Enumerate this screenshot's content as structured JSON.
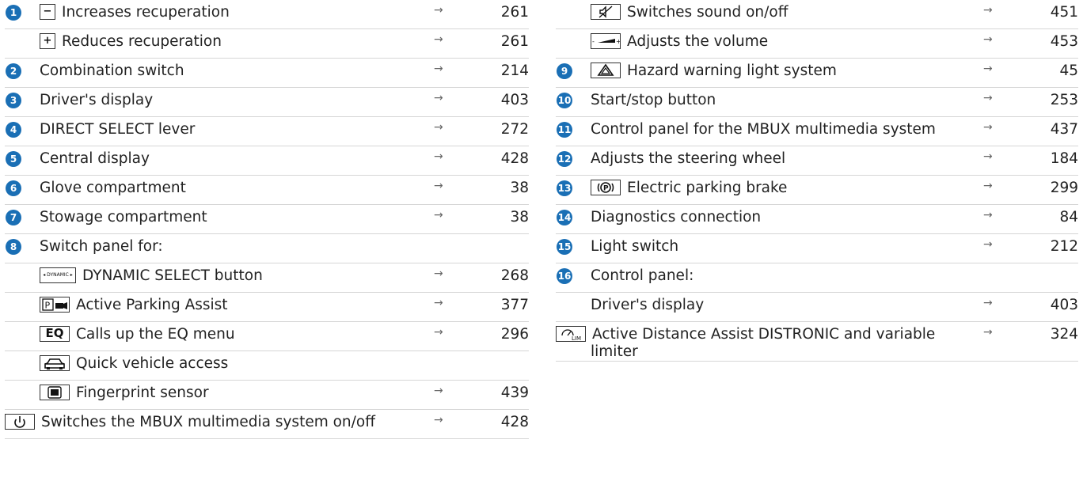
{
  "arrow": "→",
  "left": [
    {
      "badge": "1",
      "key": "minus",
      "key_text": "−",
      "text": "Increases recuperation",
      "page": "261"
    },
    {
      "badge": "",
      "key": "plus",
      "key_text": "+",
      "text": "Reduces recuperation",
      "page": "261"
    },
    {
      "badge": "2",
      "key": "",
      "text": "Combination switch",
      "page": "214"
    },
    {
      "badge": "3",
      "key": "",
      "text": "Driver's display",
      "page": "403"
    },
    {
      "badge": "4",
      "key": "",
      "text": "DIRECT SELECT lever",
      "page": "272"
    },
    {
      "badge": "5",
      "key": "",
      "text": "Central display",
      "page": "428"
    },
    {
      "badge": "6",
      "key": "",
      "text": "Glove compartment",
      "page": "38"
    },
    {
      "badge": "7",
      "key": "",
      "text": "Stowage compartment",
      "page": "38"
    },
    {
      "badge": "8",
      "key": "",
      "text": "Switch panel for:",
      "page": ""
    },
    {
      "badge": "",
      "key": "dynamic",
      "key_text": "DYNAMIC",
      "text": "DYNAMIC SELECT button",
      "page": "268"
    },
    {
      "badge": "",
      "key": "parking",
      "key_text": "P",
      "text": "Active Parking Assist",
      "page": "377"
    },
    {
      "badge": "",
      "key": "eq",
      "key_text": "EQ",
      "text": "Calls up the EQ menu",
      "page": "296"
    },
    {
      "badge": "",
      "key": "car",
      "text": "Quick vehicle access",
      "page": ""
    },
    {
      "badge": "",
      "key": "finger",
      "text": "Fingerprint sensor",
      "page": "439"
    },
    {
      "badge": "",
      "key": "power",
      "text": "Switches the MBUX multimedia system on/off",
      "page": "428"
    }
  ],
  "right": [
    {
      "badge": "",
      "key": "mute",
      "text": "Switches sound on/off",
      "page": "451"
    },
    {
      "badge": "",
      "key": "volume",
      "text": "Adjusts the volume",
      "page": "453"
    },
    {
      "badge": "9",
      "key": "hazard",
      "text": "Hazard warning light system",
      "page": "45"
    },
    {
      "badge": "10",
      "key": "",
      "text": "Start/stop button",
      "page": "253"
    },
    {
      "badge": "11",
      "key": "",
      "text": "Control panel for the MBUX multimedia system",
      "page": "437"
    },
    {
      "badge": "12",
      "key": "",
      "text": "Adjusts the steering wheel",
      "page": "184"
    },
    {
      "badge": "13",
      "key": "pbrake",
      "key_text": "P",
      "text": "Electric parking brake",
      "page": "299"
    },
    {
      "badge": "14",
      "key": "",
      "text": "Diagnostics connection",
      "page": "84"
    },
    {
      "badge": "15",
      "key": "",
      "text": "Light switch",
      "page": "212"
    },
    {
      "badge": "16",
      "key": "",
      "text": "Control panel:",
      "page": ""
    },
    {
      "badge": "",
      "key": "",
      "text": "Driver's display",
      "page": "403"
    },
    {
      "badge": "",
      "key": "distronic",
      "key_text": "LIM",
      "text": "Active Distance Assist DISTRONIC and variable limiter",
      "page": "324"
    }
  ],
  "colors": {
    "badge": "#1a6fb5",
    "rule": "#d6d6d6"
  }
}
